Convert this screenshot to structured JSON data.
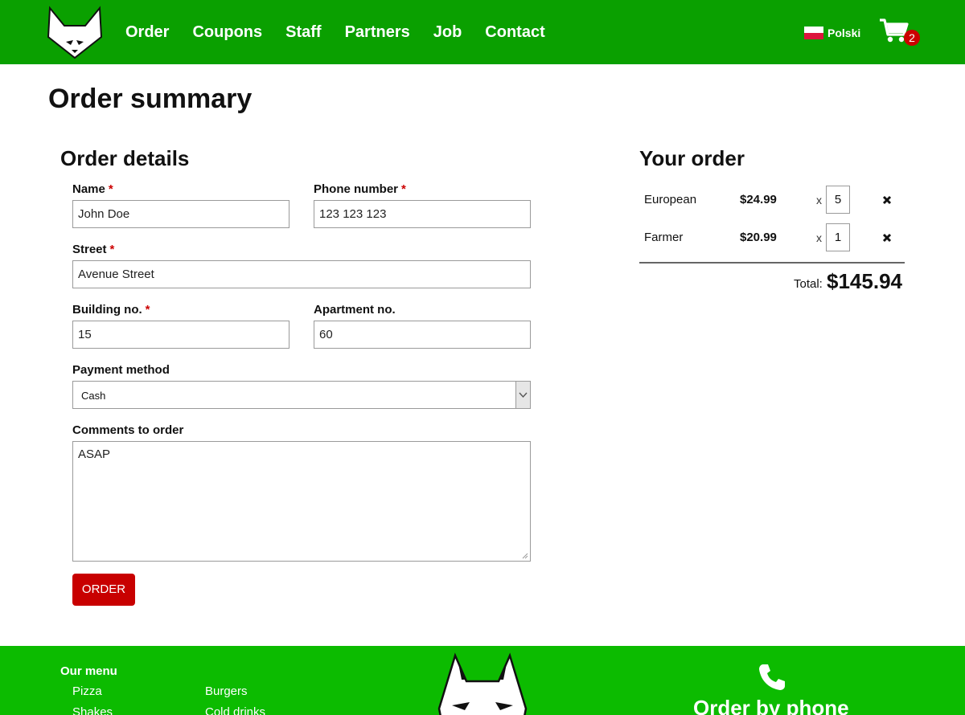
{
  "header": {
    "nav": [
      "Order",
      "Coupons",
      "Staff",
      "Partners",
      "Job",
      "Contact"
    ],
    "language": "Polski",
    "cart_count": "2"
  },
  "page_title": "Order summary",
  "order_details": {
    "title": "Order details",
    "name_label": "Name",
    "name_value": "John Doe",
    "phone_label": "Phone number",
    "phone_value": "123 123 123",
    "street_label": "Street",
    "street_value": "Avenue Street",
    "building_label": "Building no.",
    "building_value": "15",
    "apartment_label": "Apartment no.",
    "apartment_value": "60",
    "payment_label": "Payment method",
    "payment_value": "Cash",
    "comments_label": "Comments to order",
    "comments_value": "ASAP",
    "required_mark": "*",
    "submit_label": "ORDER"
  },
  "your_order": {
    "title": "Your order",
    "items": [
      {
        "name": "European",
        "price": "$24.99",
        "x": "x",
        "qty": "5"
      },
      {
        "name": "Farmer",
        "price": "$20.99",
        "x": "x",
        "qty": "1"
      }
    ],
    "total_label": "Total:",
    "total_value": "$145.94"
  },
  "footer": {
    "menu_title": "Our menu",
    "links": [
      "Pizza",
      "Burgers",
      "Shakes",
      "Cold drinks"
    ],
    "phone_title": "Order by phone"
  },
  "colors": {
    "header_green": "#0aa000",
    "footer_green": "#0cbb00",
    "accent_red": "#c80000"
  }
}
